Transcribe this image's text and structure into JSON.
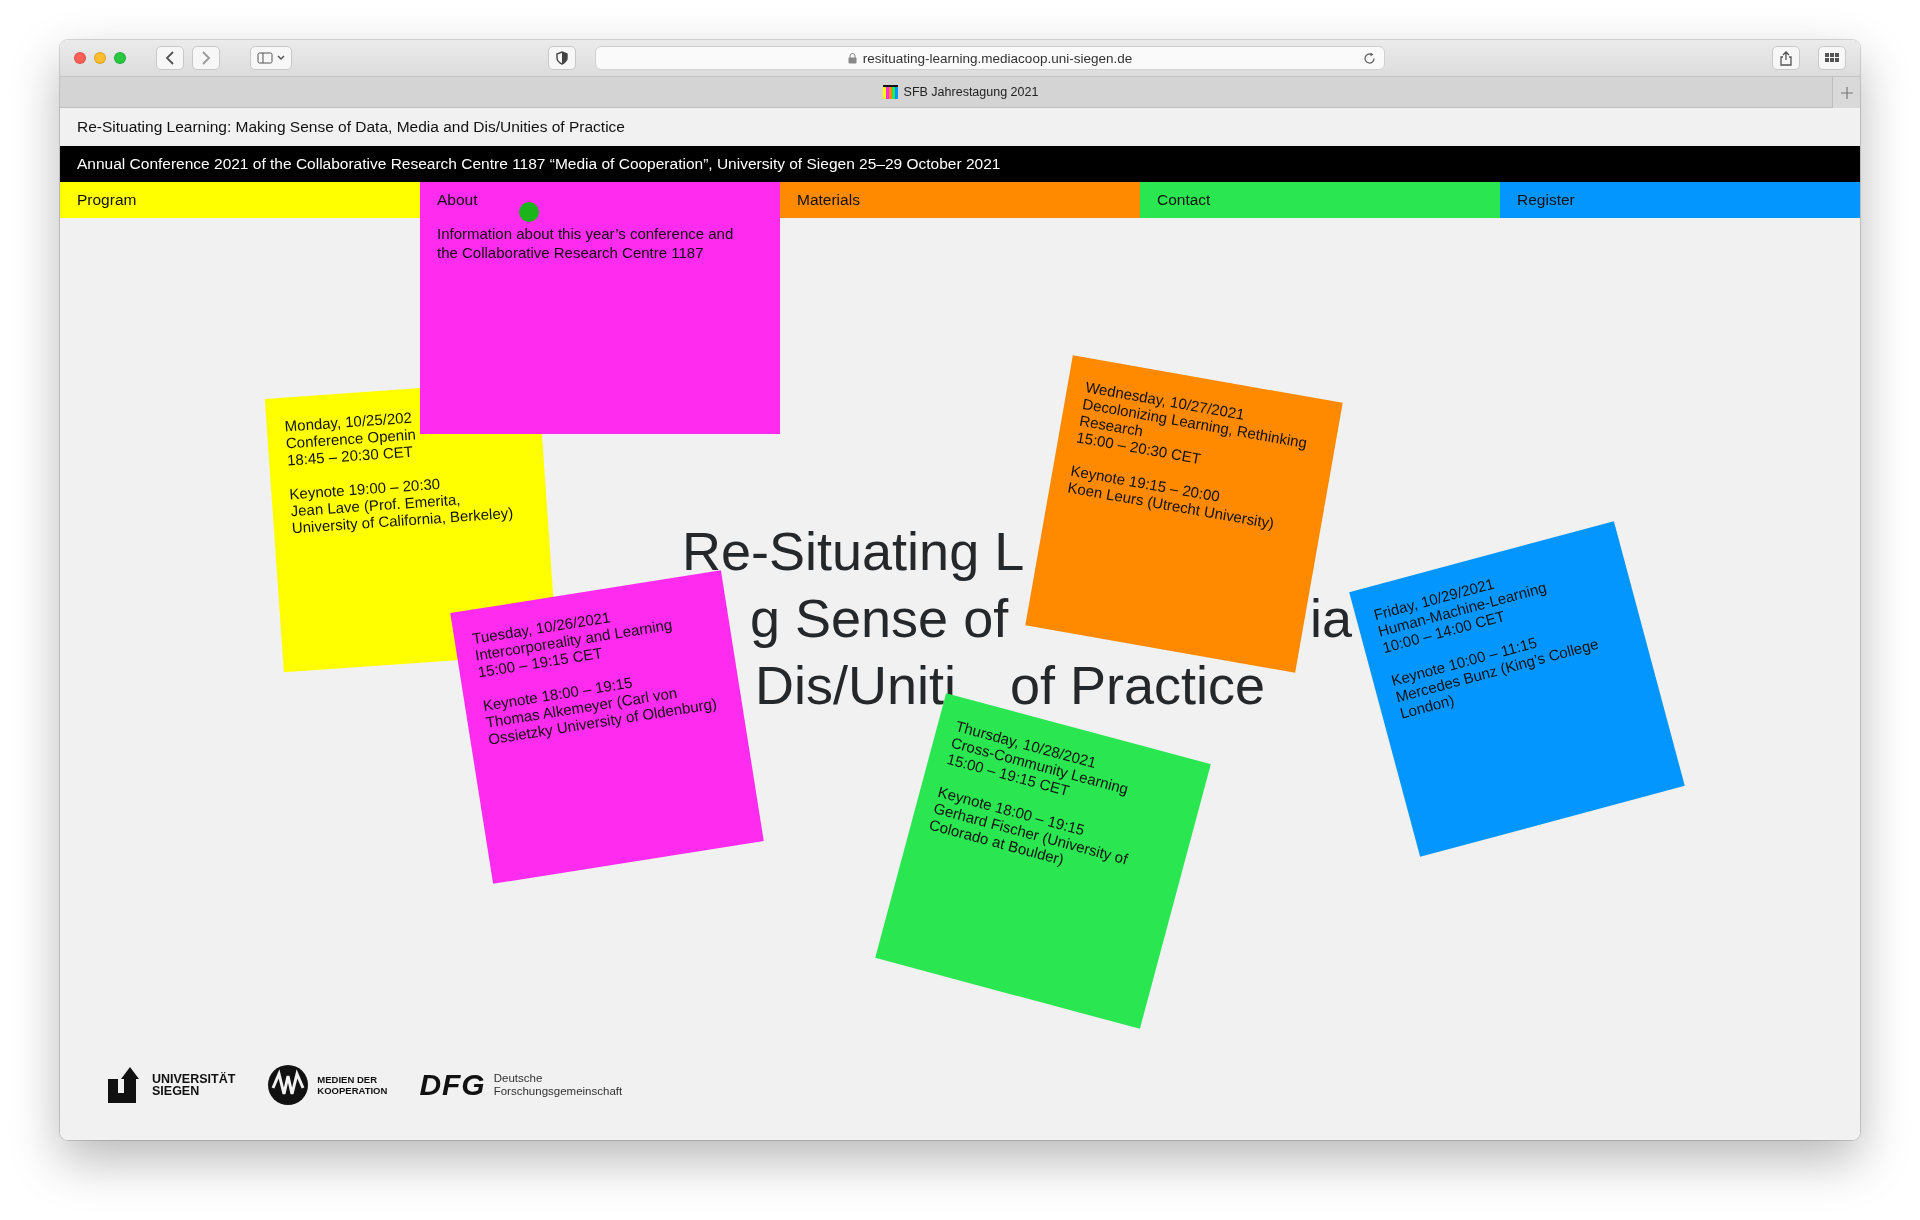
{
  "browser": {
    "url": "resituating-learning.mediacoop.uni-siegen.de",
    "tab_title": "SFB Jahrestagung 2021"
  },
  "site_title": "Re-Situating Learning: Making Sense of Data, Media and Dis/Unities of Practice",
  "announcement": "Annual Conference 2021 of the Collaborative Research Centre 1187 “Media of Cooperation”, University of Siegen 25–29 October 2021",
  "nav": [
    {
      "label": "Program",
      "color": "#ffff00",
      "selected": false
    },
    {
      "label": "About",
      "color": "#ff2bee",
      "selected": true
    },
    {
      "label": "Materials",
      "color": "#ff8a00",
      "selected": false
    },
    {
      "label": "Contact",
      "color": "#2ae650",
      "selected": false
    },
    {
      "label": "Register",
      "color": "#0496ff",
      "selected": false
    }
  ],
  "dropdown": {
    "text": "Information about this year’s conference and the Collaborative Research Centre 1187"
  },
  "hero_title": [
    [
      "Re-Situating L"
    ],
    [
      "g Sense of",
      "ia"
    ],
    [
      "Dis/Uniti",
      "of Practice"
    ]
  ],
  "notes": [
    {
      "color": "#ffff00",
      "date": "Monday, 10/25/202",
      "session": "Conference Openin",
      "time": "18:45 – 20:30 CET",
      "keynote": "Keynote 19:00 – 20:30",
      "speaker": "Jean Lave (Prof. Emerita, University of California, Berkeley)"
    },
    {
      "color": "#ff2bee",
      "date": "Tuesday, 10/26/2021",
      "session": "Intercorporeality and Learning",
      "time": "15:00 – 19:15 CET",
      "keynote": "Keynote 18:00 – 19:15",
      "speaker": "Thomas Alkemeyer (Carl von Ossietzky University of Oldenburg)"
    },
    {
      "color": "#ff8a00",
      "date": "Wednesday, 10/27/2021",
      "session": "Decolonizing Learning, Rethinking Research",
      "time": "15:00 – 20:30 CET",
      "keynote": "Keynote 19:15 – 20:00",
      "speaker": "Koen Leurs (Utrecht University)"
    },
    {
      "color": "#2ae650",
      "date": "Thursday, 10/28/2021",
      "session": "Cross-Community Learning",
      "time": "15:00 – 19:15 CET",
      "keynote": "Keynote 18:00 – 19:15",
      "speaker": "Gerhard Fischer (University of Colorado at Boulder)"
    },
    {
      "color": "#0496ff",
      "date": "Friday, 10/29/2021",
      "session": "Human-Machine-Learning",
      "time": "10:00 – 14:00 CET",
      "keynote": "Keynote 10:00 – 11:15",
      "speaker": "Mercedes Bunz (King’s College London)"
    }
  ],
  "logos": [
    {
      "kind": "siegen",
      "lines": [
        "UNIVERSITÄT",
        "SIEGEN"
      ]
    },
    {
      "kind": "mediacoop",
      "lines": [
        "MEDIEN DER",
        "KOOPERATION"
      ]
    },
    {
      "kind": "dfg",
      "mark": "DFG",
      "lines": [
        "Deutsche",
        "Forschungsgemeinschaft"
      ]
    }
  ]
}
